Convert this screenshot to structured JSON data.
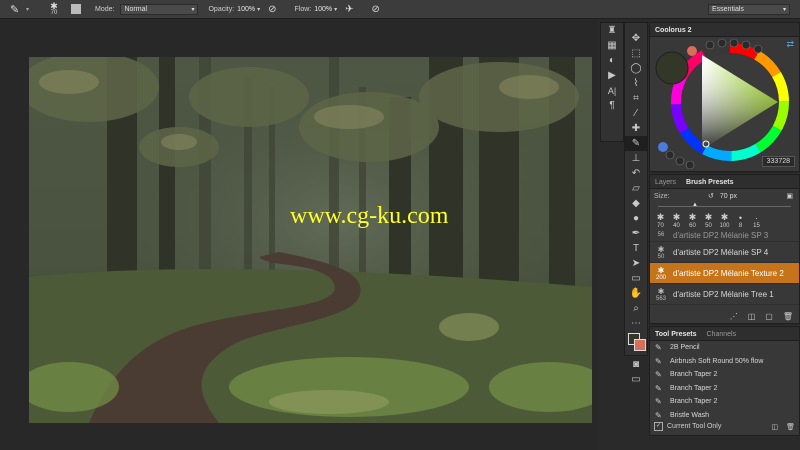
{
  "options_bar": {
    "brush_size": "70",
    "mode_label": "Mode:",
    "mode_value": "Normal",
    "opacity_label": "Opacity:",
    "opacity_value": "100%",
    "flow_label": "Flow:",
    "flow_value": "100%",
    "workspace": "Essentials"
  },
  "watermark": "www.cg-ku.com",
  "coolorus": {
    "title": "Coolorus 2",
    "hex": "333728",
    "accent": "#8fd400"
  },
  "brush_presets": {
    "tabs": [
      "Layers",
      "Brush Presets"
    ],
    "size_label": "Size:",
    "size_value": "70 px",
    "tip_sizes": [
      "70",
      "40",
      "60",
      "50",
      "100",
      "8",
      "15"
    ],
    "brushes": [
      {
        "size": "56",
        "name": "d'artiste DP2 Mélanie SP 3"
      },
      {
        "size": "50",
        "name": "d'artiste DP2 Mélanie SP 4"
      },
      {
        "size": "200",
        "name": "d'artiste DP2 Mélanie Texture 2"
      },
      {
        "size": "563",
        "name": "d'artiste DP2 Mélanie Tree 1"
      }
    ],
    "selected_index": 2,
    "selected_color": "#c6741a"
  },
  "tool_presets": {
    "tabs": [
      "Tool Presets",
      "Channels"
    ],
    "items": [
      "2B Pencil",
      "Airbrush Soft Round 50% flow",
      "Branch Taper 2",
      "Branch Taper 2",
      "Branch Taper 2",
      "Bristle Wash"
    ],
    "current_tool_only": "Current Tool Only"
  },
  "tools": [
    "move-icon",
    "marquee-icon",
    "lasso-icon",
    "quick-select-icon",
    "crop-icon",
    "eyedropper-icon",
    "healing-icon",
    "brush-icon",
    "stamp-icon",
    "history-brush-icon",
    "eraser-icon",
    "gradient-icon",
    "dodge-icon",
    "pen-icon",
    "type-icon",
    "path-select-icon",
    "shape-icon",
    "hand-icon",
    "zoom-icon",
    "more-icon"
  ]
}
